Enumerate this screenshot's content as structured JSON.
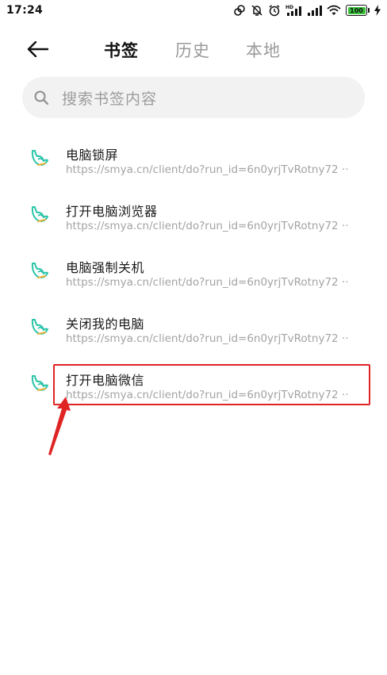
{
  "status_bar": {
    "time": "17:24",
    "battery": "100",
    "battery_percent": 100,
    "icons": [
      "link-icon",
      "mute-icon",
      "alarm-icon",
      "hd-signal-icon",
      "signal-icon",
      "wifi-icon",
      "battery-icon",
      "charging-icon"
    ]
  },
  "header": {
    "back_icon": "arrow-left-icon",
    "tabs": [
      {
        "label": "书签",
        "active": true
      },
      {
        "label": "历史",
        "active": false
      },
      {
        "label": "本地",
        "active": false
      }
    ]
  },
  "search": {
    "placeholder": "搜索书签内容",
    "icon": "search-icon"
  },
  "bookmarks": [
    {
      "title": "电脑锁屏",
      "url": "https://smya.cn/client/do?run_id=6n0yrjTvRotny72 ··"
    },
    {
      "title": "打开电脑浏览器",
      "url": "https://smya.cn/client/do?run_id=6n0yrjTvRotny72 ··"
    },
    {
      "title": "电脑强制关机",
      "url": "https://smya.cn/client/do?run_id=6n0yrjTvRotny72 ··"
    },
    {
      "title": "关闭我的电脑",
      "url": "https://smya.cn/client/do?run_id=6n0yrjTvRotny72 ··"
    },
    {
      "title": "打开电脑微信",
      "url": "https://smya.cn/client/do?run_id=6n0yrjTvRotny72 ··",
      "highlighted": true
    }
  ],
  "colors": {
    "accent_teal": "#2bc4a8",
    "highlight_red": "#e02424",
    "battery_green": "#39c13a"
  }
}
